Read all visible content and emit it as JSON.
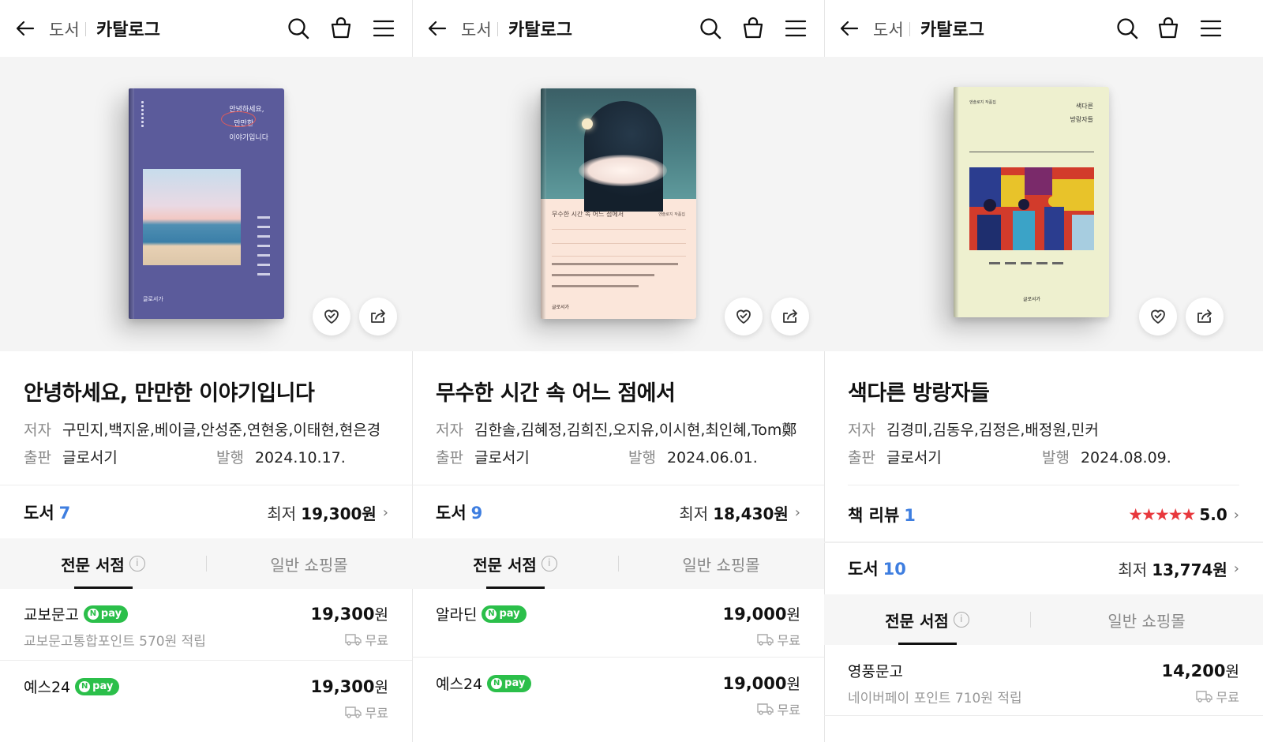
{
  "panels": [
    {
      "header": {
        "crumb": "도서",
        "title": "카탈로그"
      },
      "cover": {
        "lines": [
          "안녕하세요,",
          "만만한",
          "이야기입니다"
        ],
        "publisher": "글로서가"
      },
      "book": {
        "title": "안녕하세요, 만만한 이야기입니다",
        "author_label": "저자",
        "authors": "구민지,백지윤,베이글,안성준,연현웅,이태현,현은경",
        "publisher_label": "출판",
        "publisher": "글로서기",
        "date_label": "발행",
        "date": "2024.10.17."
      },
      "books_row": {
        "label": "도서",
        "count": "7",
        "min_label": "최저",
        "min_price": "19,300원"
      },
      "tabs": {
        "specialist": "전문 서점",
        "info_icon": "i",
        "general": "일반 쇼핑몰"
      },
      "stores": [
        {
          "name": "교보문고",
          "npay": "pay",
          "sub": "교보문고통합포인트 570원 적립",
          "price": "19,300",
          "won": "원",
          "ship": "무료"
        },
        {
          "name": "예스24",
          "npay": "pay",
          "sub": "",
          "price": "19,300",
          "won": "원",
          "ship": "무료"
        }
      ]
    },
    {
      "header": {
        "crumb": "도서",
        "title": "카탈로그"
      },
      "cover": {
        "title": "무수한 시간 속 어느 점에서",
        "series": "엔솔로지 작품집",
        "publisher": "글로서가"
      },
      "book": {
        "title": "무수한 시간 속 어느 점에서",
        "author_label": "저자",
        "authors": "김한솔,김혜정,김희진,오지유,이시현,최인혜,Tom鄭",
        "publisher_label": "출판",
        "publisher": "글로서기",
        "date_label": "발행",
        "date": "2024.06.01."
      },
      "books_row": {
        "label": "도서",
        "count": "9",
        "min_label": "최저",
        "min_price": "18,430원"
      },
      "tabs": {
        "specialist": "전문 서점",
        "info_icon": "i",
        "general": "일반 쇼핑몰"
      },
      "stores": [
        {
          "name": "알라딘",
          "npay": "pay",
          "sub": "",
          "price": "19,000",
          "won": "원",
          "ship": "무료"
        },
        {
          "name": "예스24",
          "npay": "pay",
          "sub": "",
          "price": "19,000",
          "won": "원",
          "ship": "무료"
        }
      ]
    },
    {
      "header": {
        "crumb": "도서",
        "title": "카탈로그"
      },
      "cover": {
        "lines": [
          "색다른",
          "방랑자들"
        ],
        "series": "엔솔로지 작품집",
        "publisher": "글로서가"
      },
      "book": {
        "title": "색다른 방랑자들",
        "author_label": "저자",
        "authors": "김경미,김동우,김정은,배정원,민커",
        "publisher_label": "출판",
        "publisher": "글로서기",
        "date_label": "발행",
        "date": "2024.08.09."
      },
      "review_row": {
        "label": "책 리뷰",
        "count": "1",
        "stars": "★★★★★",
        "rating": "5.0"
      },
      "books_row": {
        "label": "도서",
        "count": "10",
        "min_label": "최저",
        "min_price": "13,774원"
      },
      "tabs": {
        "specialist": "전문 서점",
        "info_icon": "i",
        "general": "일반 쇼핑몰"
      },
      "stores": [
        {
          "name": "영풍문고",
          "npay": "",
          "sub": "네이버페이 포인트 710원 적립",
          "price": "14,200",
          "won": "원",
          "ship": "무료"
        }
      ]
    }
  ],
  "colors": {
    "accent_blue": "#3e7ee0",
    "npay_green": "#2bbf4a",
    "star_red": "#e8383d"
  }
}
